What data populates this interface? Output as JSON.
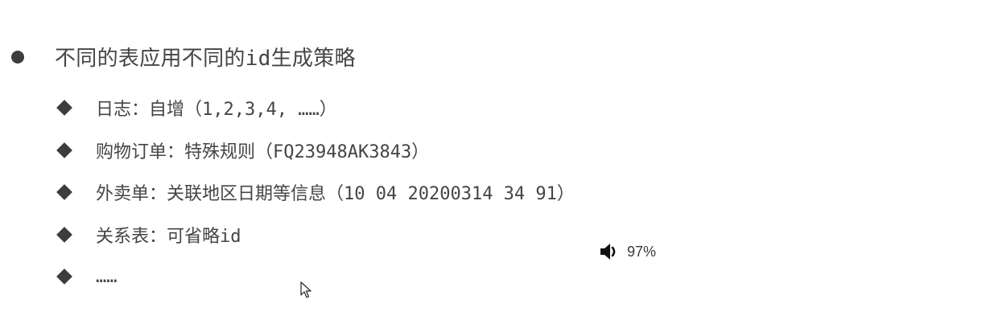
{
  "slide": {
    "main_point": "不同的表应用不同的id生成策略",
    "sub_points": [
      "日志：自增（1,2,3,4, ……）",
      "购物订单：特殊规则（FQ23948AK3843）",
      "外卖单：关联地区日期等信息（10 04 20200314 34 91）",
      "关系表：可省略id",
      "……"
    ]
  },
  "overlay": {
    "volume_icon": "speaker-volume-icon",
    "volume_percent": "97%",
    "cursor_icon": "mouse-pointer-icon"
  }
}
